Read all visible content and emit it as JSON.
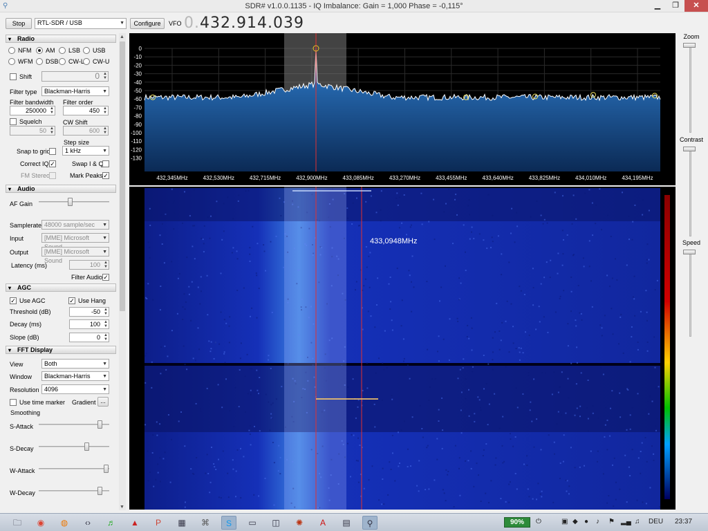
{
  "window": {
    "title": "SDR# v1.0.0.1135 - IQ Imbalance: Gain = 1,000 Phase = -0,115°",
    "minimize_label": "▁",
    "maximize_label": "❐",
    "close_label": "✕",
    "app_icon": "antenna-icon"
  },
  "toolbar": {
    "stop_label": "Stop",
    "source_value": "RTL-SDR / USB",
    "configure_label": "Configure",
    "vfo_label": "VFO",
    "vfo_prefix": "0.",
    "vfo_value": "432.914.039"
  },
  "radio": {
    "header": "Radio",
    "modes": [
      {
        "label": "NFM",
        "selected": false
      },
      {
        "label": "AM",
        "selected": true
      },
      {
        "label": "LSB",
        "selected": false
      },
      {
        "label": "USB",
        "selected": false
      },
      {
        "label": "WFM",
        "selected": false
      },
      {
        "label": "DSB",
        "selected": false
      },
      {
        "label": "CW-L",
        "selected": false
      },
      {
        "label": "CW-U",
        "selected": false
      }
    ],
    "shift_label": "Shift",
    "shift_value": "0",
    "filter_type_label": "Filter type",
    "filter_type_value": "Blackman-Harris",
    "filter_bandwidth_label": "Filter bandwidth",
    "filter_bandwidth_value": "250000",
    "filter_order_label": "Filter order",
    "filter_order_value": "450",
    "squelch_label": "Squelch",
    "squelch_value": "50",
    "cw_shift_label": "CW Shift",
    "cw_shift_value": "600",
    "step_size_label": "Step size",
    "step_size_value": "1 kHz",
    "snap_to_grid_label": "Snap to grid",
    "snap_to_grid_checked": false,
    "correct_iq_label": "Correct IQ",
    "correct_iq_checked": true,
    "swap_iq_label": "Swap I & Q",
    "swap_iq_checked": false,
    "fm_stereo_label": "FM Stereo",
    "fm_stereo_checked": false,
    "mark_peaks_label": "Mark Peaks",
    "mark_peaks_checked": true
  },
  "audio": {
    "header": "Audio",
    "af_gain_label": "AF Gain",
    "af_gain_level": 0.45,
    "samplerate_label": "Samplerate",
    "samplerate_value": "48000 sample/sec",
    "input_label": "Input",
    "input_value": "[MME] Microsoft Sound",
    "output_label": "Output",
    "output_value": "[MME] Microsoft Sound",
    "latency_label": "Latency (ms)",
    "latency_value": "100",
    "filter_audio_label": "Filter Audio",
    "filter_audio_checked": true
  },
  "agc": {
    "header": "AGC",
    "use_agc_label": "Use AGC",
    "use_agc_checked": true,
    "use_hang_label": "Use Hang",
    "use_hang_checked": true,
    "threshold_label": "Threshold (dB)",
    "threshold_value": "-50",
    "decay_label": "Decay (ms)",
    "decay_value": "100",
    "slope_label": "Slope (dB)",
    "slope_value": "0"
  },
  "fft": {
    "header": "FFT Display",
    "view_label": "View",
    "view_value": "Both",
    "window_label": "Window",
    "window_value": "Blackman-Harris",
    "resolution_label": "Resolution",
    "resolution_value": "4096",
    "time_marker_label": "Use time marker",
    "time_marker_checked": false,
    "gradient_label": "Gradient",
    "gradient_button": "...",
    "smoothing_label": "Smoothing",
    "s_attack_label": "S-Attack",
    "s_attack_level": 0.9,
    "s_decay_label": "S-Decay",
    "s_decay_level": 0.7,
    "w_attack_label": "W-Attack",
    "w_attack_level": 1.0,
    "w_decay_label": "W-Decay",
    "w_decay_level": 0.9
  },
  "spectrum": {
    "db_labels": [
      "0",
      "-10",
      "-20",
      "-30",
      "-40",
      "-50",
      "-60",
      "-70",
      "-80",
      "-90",
      "-100",
      "-110",
      "-120",
      "-130"
    ],
    "freq_labels": [
      "432,345MHz",
      "432,530MHz",
      "432,715MHz",
      "432,900MHz",
      "433,085MHz",
      "433,270MHz",
      "433,455MHz",
      "433,640MHz",
      "433,825MHz",
      "434,010MHz",
      "434,195MHz"
    ],
    "noise_floor_db": -60,
    "peak_db": 0,
    "peak_markers_db": [
      -58,
      -58,
      -57,
      -55,
      -56,
      -58
    ],
    "line_color": "#ffffff",
    "fill_color": "#2f7fd0",
    "center_line_color": "#e23030",
    "filter_band_color": "#7a7a7a"
  },
  "waterfall": {
    "hover_freq": "433,0948MHz",
    "base_color": "#1530b8",
    "bright_color": "#3a7fe0"
  },
  "right_panel": {
    "zoom_label": "Zoom",
    "zoom_level": 0.0,
    "contrast_label": "Contrast",
    "contrast_level": 0.0,
    "speed_label": "Speed",
    "speed_level": 1.0
  },
  "taskbar": {
    "icons": [
      "explorer-icon",
      "chrome-icon",
      "firefox-icon",
      "code-icon",
      "spotify-icon",
      "acrobat-icon",
      "powerpoint-icon",
      "calculator-icon",
      "network-icon",
      "skype-icon",
      "remote-icon",
      "media-icon",
      "burn-icon",
      "pdf-icon",
      "display-icon",
      "sdr-icon"
    ],
    "battery": "90%",
    "language": "DEU",
    "time": "23:37"
  }
}
